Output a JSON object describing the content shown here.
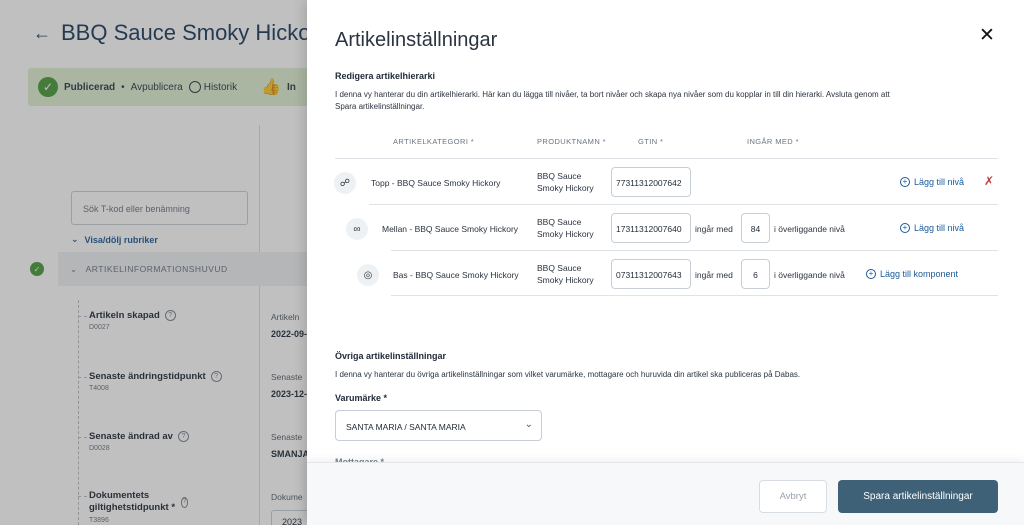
{
  "background": {
    "title": "BBQ Sauce Smoky Hickor",
    "status": "Publicerad",
    "separator": "•",
    "unpublish": "Avpublicera",
    "history": "Historik",
    "partial_label": "In",
    "search_placeholder": "Sök T-kod eller benämning",
    "toggle_headings": "Visa/dölj rubriker",
    "section_title": "ARTIKELINFORMATIONSHUVUD",
    "fields": [
      {
        "label": "Artikeln skapad",
        "code": "D0027",
        "value_label": "Artikeln",
        "value": "2022-09-"
      },
      {
        "label": "Senaste ändringstidpunkt",
        "code": "T4008",
        "value_label": "Senaste",
        "value": "2023-12-"
      },
      {
        "label": "Senaste ändrad av",
        "code": "D0028",
        "value_label": "Senaste",
        "value": "SMANJA"
      },
      {
        "label": "Dokumentets giltighetstidpunkt *",
        "code": "T3896",
        "value_label": "Dokume",
        "value": "2023"
      }
    ]
  },
  "modal": {
    "title": "Artikelinställningar",
    "hierarchy": {
      "heading": "Redigera artikelhierarki",
      "description": "I denna vy hanterar du din artikelhierarki. Här kan du lägga till nivåer, ta bort nivåer och skapa nya nivåer som du kopplar in till din hierarki. Avsluta genom att Spara artikelinställningar.",
      "columns": {
        "category": "ARTIKELKATEGORI *",
        "product": "PRODUKTNAMN *",
        "gtin": "GTIN *",
        "included": "INGÅR MED *"
      },
      "rows": [
        {
          "category": "Topp - BBQ Sauce Smoky Hickory",
          "product": "BBQ Sauce Smoky Hickory",
          "gtin": "77311312007642",
          "action": "Lägg till nivå"
        },
        {
          "category": "Mellan - BBQ Sauce Smoky Hickory",
          "product": "BBQ Sauce Smoky Hickory",
          "gtin": "17311312007640",
          "included_text": "ingår med",
          "qty": "84",
          "parent_text": "i överliggande nivå",
          "action": "Lägg till nivå"
        },
        {
          "category": "Bas - BBQ Sauce Smoky Hickory",
          "product": "BBQ Sauce Smoky Hickory",
          "gtin": "07311312007643",
          "included_text": "ingår med",
          "qty": "6",
          "parent_text": "i överliggande nivå",
          "action": "Lägg till komponent"
        }
      ]
    },
    "other": {
      "heading": "Övriga artikelinställningar",
      "description": "I denna vy hanterar du övriga artikelinställningar som vilket varumärke, mottagare och huruvida din artikel ska publiceras på Dabas.",
      "brand_label": "Varumärke *",
      "brand_value": "SANTA MARIA / SANTA MARIA",
      "next_label": "Mottagare *"
    },
    "footer": {
      "cancel": "Avbryt",
      "save": "Spara artikelinställningar"
    }
  }
}
